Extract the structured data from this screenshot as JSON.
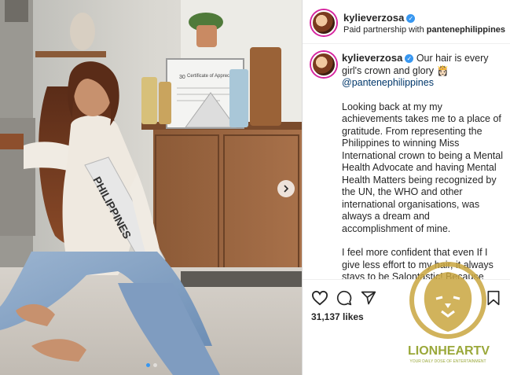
{
  "post": {
    "username": "kylieverzosa",
    "partnership_prefix": "Paid partnership with",
    "partner": "pantenephilippines",
    "caption_title": "Our hair is every girl's crown and glory 👸🏻",
    "mention": "@pantenephilippines",
    "caption_paragraphs": [
      "Looking back at my my achievements takes me to a place of gratitude. From representing the Philippines to winning Miss International crown to being a Mental Health Advocate and having Mental Health Matters being recognized by the UN, the WHO and other international organisations, was always a dream and accomplishment of mine.",
      "I feel more confident that even If I give less effort to my hair, it always stays to be Salontastic! Because with Salontastic hair, I feel empowered to own those moments."
    ],
    "likes": "31,137 likes"
  },
  "photo": {
    "sash_text": "PHILIPPINES",
    "certificate_title": "Certificate of Appreciation",
    "certificate_number": "30"
  },
  "icons": [
    "heart-icon",
    "comment-icon",
    "share-icon",
    "bookmark-icon",
    "verified-badge-icon",
    "chevron-right-icon"
  ],
  "watermark": {
    "brand": "LIONHEARTV",
    "tagline": "YOUR DAILY DOSE OF ENTERTAINMENT"
  },
  "colors": {
    "verified": "#3897f0",
    "link": "#00376b",
    "text": "#262626",
    "watermark": "#c9a640"
  }
}
